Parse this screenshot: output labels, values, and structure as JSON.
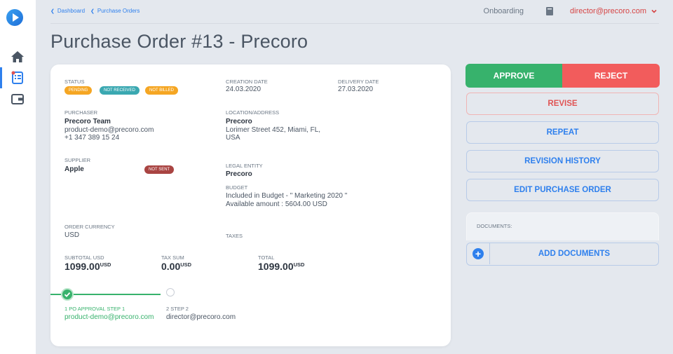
{
  "breadcrumb": [
    {
      "label": "Dashboard"
    },
    {
      "label": "Purchase Orders"
    }
  ],
  "header": {
    "onboarding": "Onboarding",
    "user_email": "director@precoro.com"
  },
  "page_title": "Purchase Order #13 - Precoro",
  "order": {
    "status_label": "STATUS",
    "badges": [
      {
        "label": "PENDING",
        "color": "#f5a623"
      },
      {
        "label": "NOT RECEIVED",
        "color": "#3aa8b1"
      },
      {
        "label": "NOT BILLED",
        "color": "#f5a623"
      }
    ],
    "creation_date_label": "CREATION DATE",
    "creation_date": "24.03.2020",
    "delivery_date_label": "DELIVERY DATE",
    "delivery_date": "27.03.2020",
    "purchaser_label": "PURCHASER",
    "purchaser_name": "Precoro Team",
    "purchaser_email": "product-demo@precoro.com",
    "purchaser_phone": "+1 347 389 15 24",
    "location_label": "LOCATION/ADDRESS",
    "location_name": "Precoro",
    "location_line1": "Lorimer Street 452, Miami, FL,",
    "location_line2": "USA",
    "supplier_label": "SUPPLIER",
    "supplier_name": "Apple",
    "supplier_badge": "NOT SENT",
    "legal_entity_label": "LEGAL ENTITY",
    "legal_entity": "Precoro",
    "budget_label": "BUDGET",
    "budget_line1": "Included in Budget - \" Marketing 2020 \"",
    "budget_line2": "Available amount : 5604.00 USD",
    "currency_label": "ORDER CURRENCY",
    "currency": "USD",
    "taxes_label": "TAXES",
    "subtotal_label": "SUBTOTAL USD",
    "subtotal": "1099.00",
    "subtotal_unit": "USD",
    "tax_sum_label": "TAX SUM",
    "tax_sum": "0.00",
    "tax_sum_unit": "USD",
    "total_label": "TOTAL",
    "total": "1099.00",
    "total_unit": "USD"
  },
  "approval_steps": [
    {
      "title": "1 PO APPROVAL STEP 1",
      "email": "product-demo@precoro.com",
      "done": true
    },
    {
      "title": "2 STEP 2",
      "email": "director@precoro.com",
      "done": false
    }
  ],
  "actions": {
    "approve": "APPROVE",
    "reject": "REJECT",
    "revise": "REVISE",
    "repeat": "REPEAT",
    "revision_history": "REVISION HISTORY",
    "edit": "EDIT PURCHASE ORDER",
    "documents_label": "DOCUMENTS:",
    "add_documents": "ADD DOCUMENTS"
  },
  "colors": {
    "accent": "#2f80ed",
    "approve": "#37b26c",
    "reject": "#f25c5c",
    "badge_danger": "#a94442"
  },
  "icons": [
    "logo-icon",
    "home-icon",
    "purchase-orders-icon",
    "wallet-icon",
    "book-icon",
    "chevron-down-icon",
    "check-icon",
    "plus-icon"
  ]
}
